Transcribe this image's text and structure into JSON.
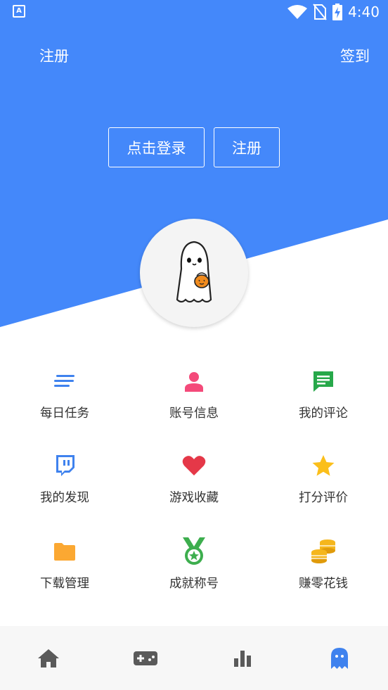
{
  "status_bar": {
    "time": "4:40",
    "app_icon_letter": "A"
  },
  "header": {
    "left_link": "注册",
    "right_link": "签到",
    "login_button": "点击登录",
    "register_button": "注册",
    "bg_color": "#4488fa"
  },
  "menu": [
    {
      "label": "每日任务",
      "icon": "list-lines-icon",
      "color": "#3f82ee"
    },
    {
      "label": "账号信息",
      "icon": "person-icon",
      "color": "#f44a7a"
    },
    {
      "label": "我的评论",
      "icon": "comment-icon",
      "color": "#27a84a"
    },
    {
      "label": "我的发现",
      "icon": "twitch-icon",
      "color": "#3f82ee"
    },
    {
      "label": "游戏收藏",
      "icon": "heart-icon",
      "color": "#e53848"
    },
    {
      "label": "打分评价",
      "icon": "star-icon",
      "color": "#fbbf1b"
    },
    {
      "label": "下载管理",
      "icon": "folder-icon",
      "color": "#fba832"
    },
    {
      "label": "成就称号",
      "icon": "medal-icon",
      "color": "#3dae4e"
    },
    {
      "label": "赚零花钱",
      "icon": "coins-icon",
      "color": "#f5b61c"
    }
  ],
  "tabbar": {
    "items": [
      "home-icon",
      "gamepad-icon",
      "bar-chart-icon",
      "ghost-icon"
    ],
    "active_index": 3,
    "active_color": "#3f82ee",
    "inactive_color": "#5a5a5a"
  }
}
